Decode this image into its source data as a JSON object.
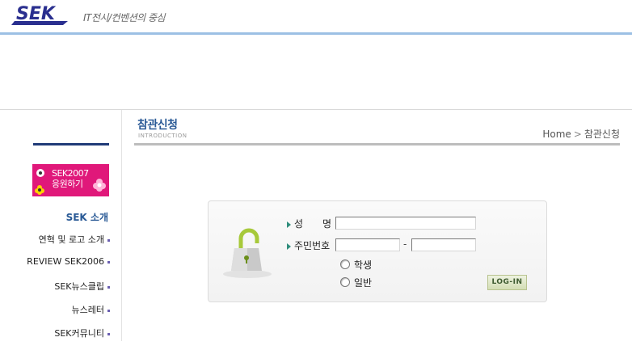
{
  "header": {
    "logo_text": "SEK",
    "tagline": "IT전시/컨벤션의 중심"
  },
  "sidebar": {
    "cheer_banner": {
      "line1": "SEK2007",
      "line2": "응원하기"
    },
    "section_title": "SEK 소개",
    "items": [
      {
        "label": "연혁 및 로고 소개"
      },
      {
        "label": "REVIEW SEK2006"
      },
      {
        "label": "SEK뉴스클립"
      },
      {
        "label": "뉴스레터"
      },
      {
        "label": "SEK커뮤니티"
      }
    ]
  },
  "main": {
    "title": "참관신청",
    "subtitle": "INTRODUCTION",
    "breadcrumb": {
      "home": "Home",
      "separator": ">",
      "current": "참관신청"
    }
  },
  "login": {
    "name_label": "성　　명",
    "name_value": "",
    "id_label": "주민번호",
    "id_front_value": "",
    "id_back_value": "",
    "id_dash": "-",
    "radio_student": "학생",
    "radio_general": "일반",
    "button_label": "LOG-IN"
  },
  "colors": {
    "accent_blue": "#2a5a96",
    "navy_bar": "#203b78",
    "header_rule": "#9cc0e4",
    "banner_pink": "#e0187a"
  }
}
